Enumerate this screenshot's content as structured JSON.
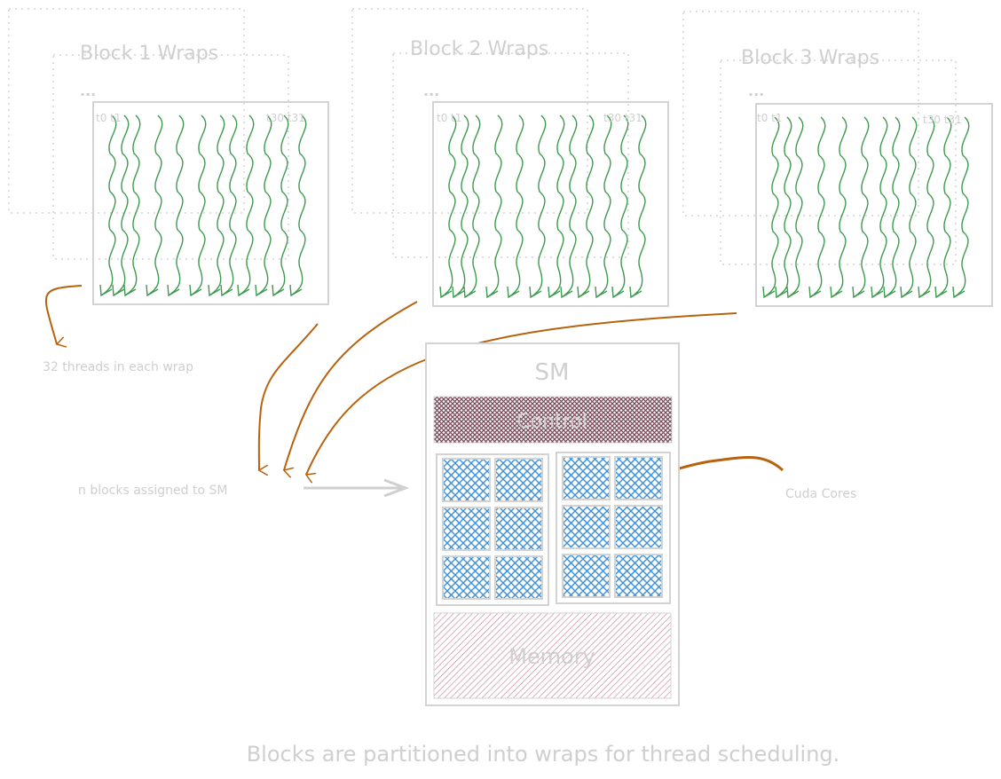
{
  "blocks": [
    {
      "title": "Block 1 Wraps",
      "ellipsis": "...",
      "first_threads": "t0 t1",
      "last_threads": "t30 t31"
    },
    {
      "title": "Block 2 Wraps",
      "ellipsis": "...",
      "first_threads": "t0 t1",
      "last_threads": "t30 t31"
    },
    {
      "title": "Block 3 Wraps",
      "ellipsis": "...",
      "first_threads": "t0 t1",
      "last_threads": "t30 t31"
    }
  ],
  "annotations": {
    "threads_per_wrap": "32 threads in each wrap",
    "blocks_assigned": "n blocks assigned to SM",
    "cuda_cores": "Cuda Cores"
  },
  "sm": {
    "title": "SM",
    "control_label": "Control",
    "memory_label": "Memory",
    "core_groups": 2,
    "cores_per_group": 6
  },
  "caption": "Blocks are partitioned into wraps for thread scheduling.",
  "colors": {
    "thread": "#3d9a4e",
    "arrow": "#b8620e",
    "outline": "#d3d3d3",
    "text": "#cfcfcf",
    "control": "#7a4a5a",
    "core": "#3a8fd9",
    "memory": "#c77a95"
  }
}
